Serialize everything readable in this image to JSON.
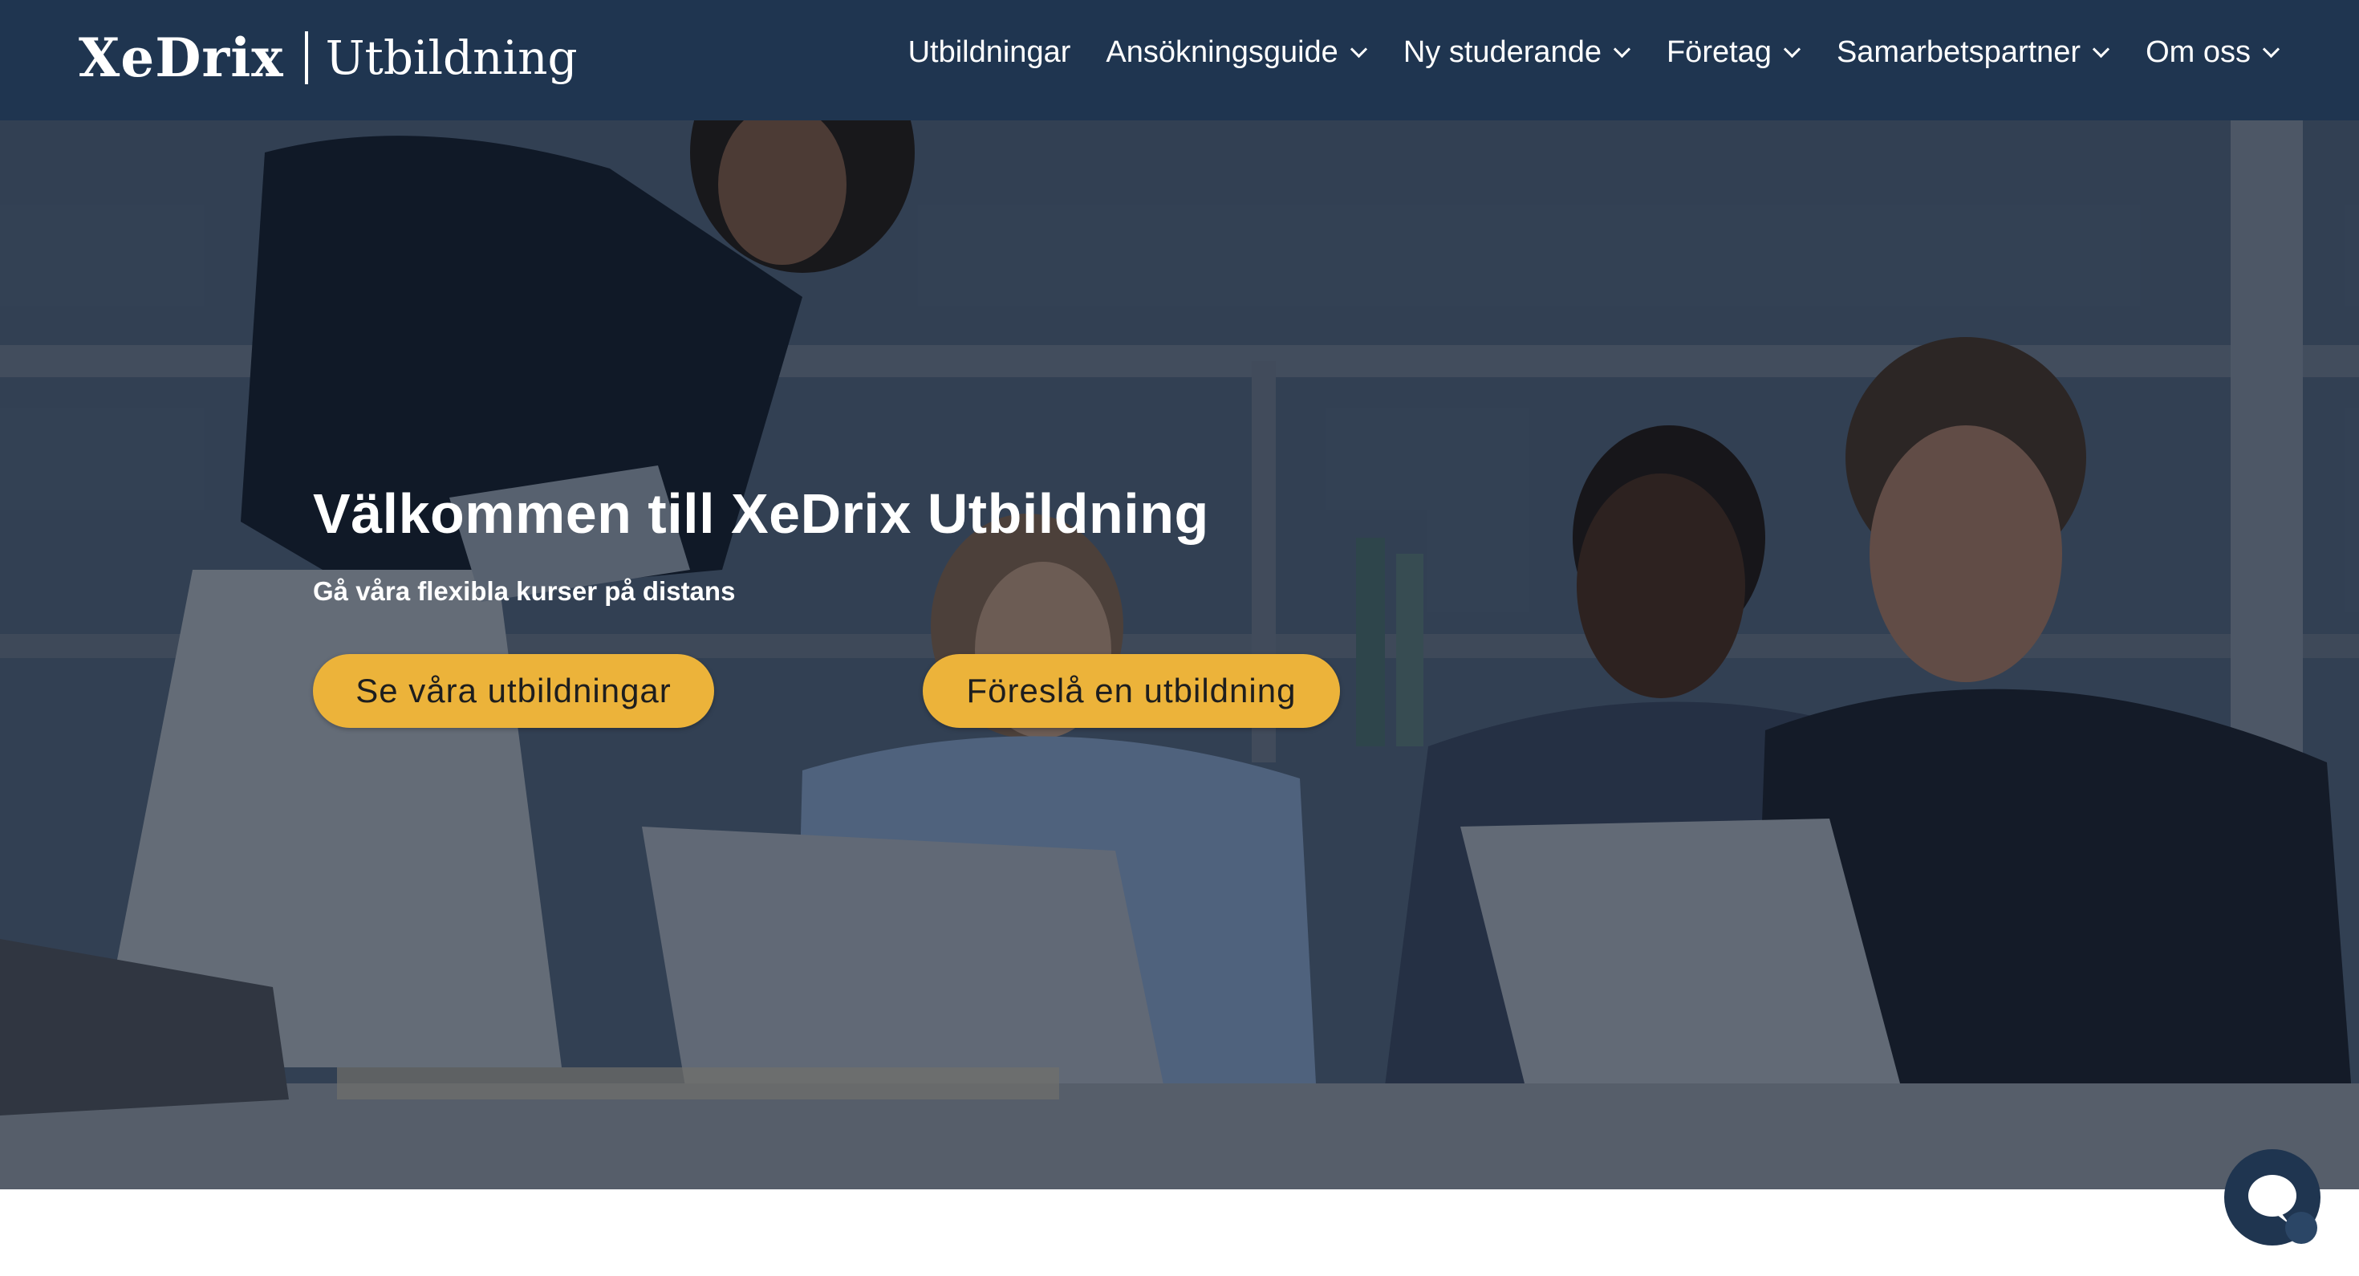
{
  "header": {
    "brand_name": "XeDrix",
    "brand_sub": "Utbildning",
    "nav": [
      {
        "label": "Utbildningar",
        "dropdown": false
      },
      {
        "label": "Ansökningsguide",
        "dropdown": true
      },
      {
        "label": "Ny studerande",
        "dropdown": true
      },
      {
        "label": "Företag",
        "dropdown": true
      },
      {
        "label": "Samarbetspartner",
        "dropdown": true
      },
      {
        "label": "Om oss",
        "dropdown": true
      }
    ]
  },
  "hero": {
    "title": "Välkommen till XeDrix Utbildning",
    "subtitle": "Gå våra flexibla kurser på distans",
    "primary_button": "Se våra utbildningar",
    "secondary_button": "Föreslå en utbildning"
  },
  "chat": {
    "icon": "chat-bubble-icon"
  },
  "colors": {
    "header_bg": "#1f3550",
    "button_bg": "#ecb33a",
    "text_light": "#ffffff"
  }
}
